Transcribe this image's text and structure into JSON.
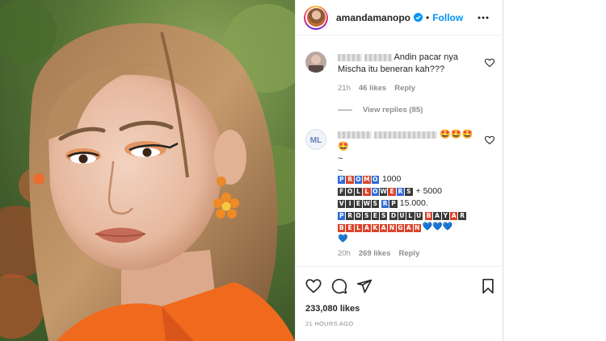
{
  "post": {
    "username": "amandamanopo",
    "follow_label": "Follow",
    "separator": "•",
    "likes": "233,080 likes",
    "time_ago": "21 HOURS AGO"
  },
  "comments": [
    {
      "text_line1": "Andin pacar nya",
      "text_line2": "Mischa itu beneran kah???",
      "time": "21h",
      "likes": "46 likes",
      "reply_label": "Reply",
      "view_replies": "View replies (85)"
    },
    {
      "emoji_line": "🤩🤩🤩",
      "emoji_line2": "🤩",
      "tilde1": "~",
      "tilde2": "~",
      "promo_word": "PROMO",
      "promo_num": "1000",
      "followers_word": "FOLLOWERS",
      "followers_num": "+ 5000",
      "views_word": "VIEWS",
      "rp_word": "RP",
      "price": "15.000.",
      "proses": "PROSES",
      "dulu": "DULU",
      "bayar": "BAYAR",
      "belakangan": "BELAKANGAN",
      "hearts": "💙💙💙",
      "heart_last": "💙",
      "time": "20h",
      "likes": "269 likes",
      "reply_label": "Reply"
    }
  ],
  "icons": {
    "verified": "verified-badge-icon",
    "more": "more-options-icon",
    "like": "heart-icon",
    "comment": "comment-icon",
    "share": "share-icon",
    "save": "bookmark-icon"
  },
  "colors": {
    "accent": "#0095f6",
    "muted": "#8e8e8e",
    "text": "#262626"
  }
}
